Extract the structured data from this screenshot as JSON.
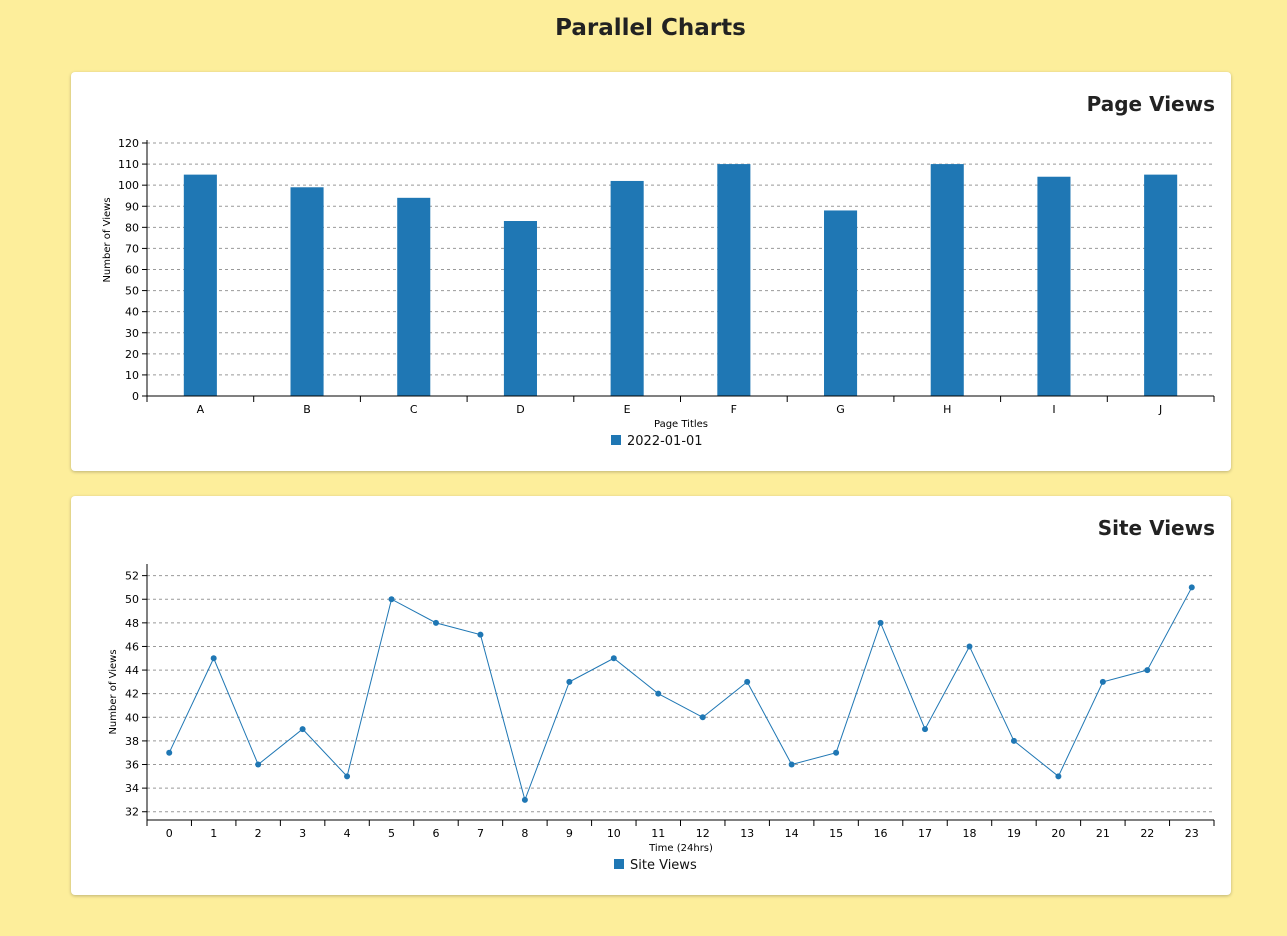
{
  "page": {
    "title": "Parallel Charts"
  },
  "charts": {
    "page_views": {
      "title": "Page Views",
      "legend": "2022-01-01",
      "xlabel": "Page Titles",
      "ylabel": "Number of Views"
    },
    "site_views": {
      "title": "Site Views",
      "legend": "Site Views",
      "xlabel": "Time (24hrs)",
      "ylabel": "Number of Views"
    }
  },
  "colors": {
    "background": "#fdee9b",
    "series": "#1f77b4",
    "grid": "#999999"
  },
  "chart_data": [
    {
      "type": "bar",
      "title": "Page Views",
      "categories": [
        "A",
        "B",
        "C",
        "D",
        "E",
        "F",
        "G",
        "H",
        "I",
        "J"
      ],
      "series": [
        {
          "name": "2022-01-01",
          "values": [
            105,
            99,
            94,
            83,
            102,
            110,
            88,
            110,
            104,
            105
          ]
        }
      ],
      "xlabel": "Page Titles",
      "ylabel": "Number of Views",
      "ylim": [
        0,
        120
      ],
      "yticks": [
        0,
        10,
        20,
        30,
        40,
        50,
        60,
        70,
        80,
        90,
        100,
        110,
        120
      ],
      "grid": true,
      "legend_position": "bottom"
    },
    {
      "type": "line",
      "title": "Site Views",
      "x": [
        0,
        1,
        2,
        3,
        4,
        5,
        6,
        7,
        8,
        9,
        10,
        11,
        12,
        13,
        14,
        15,
        16,
        17,
        18,
        19,
        20,
        21,
        22,
        23
      ],
      "series": [
        {
          "name": "Site Views",
          "values": [
            37,
            45,
            36,
            39,
            35,
            50,
            48,
            47,
            33,
            43,
            45,
            42,
            40,
            43,
            36,
            37,
            48,
            39,
            46,
            38,
            35,
            43,
            44,
            51
          ]
        }
      ],
      "xlabel": "Time (24hrs)",
      "ylabel": "Number of Views",
      "ylim": [
        31.3,
        52.9
      ],
      "yticks": [
        32,
        34,
        36,
        38,
        40,
        42,
        44,
        46,
        48,
        50,
        52
      ],
      "grid": true,
      "legend_position": "bottom"
    }
  ]
}
